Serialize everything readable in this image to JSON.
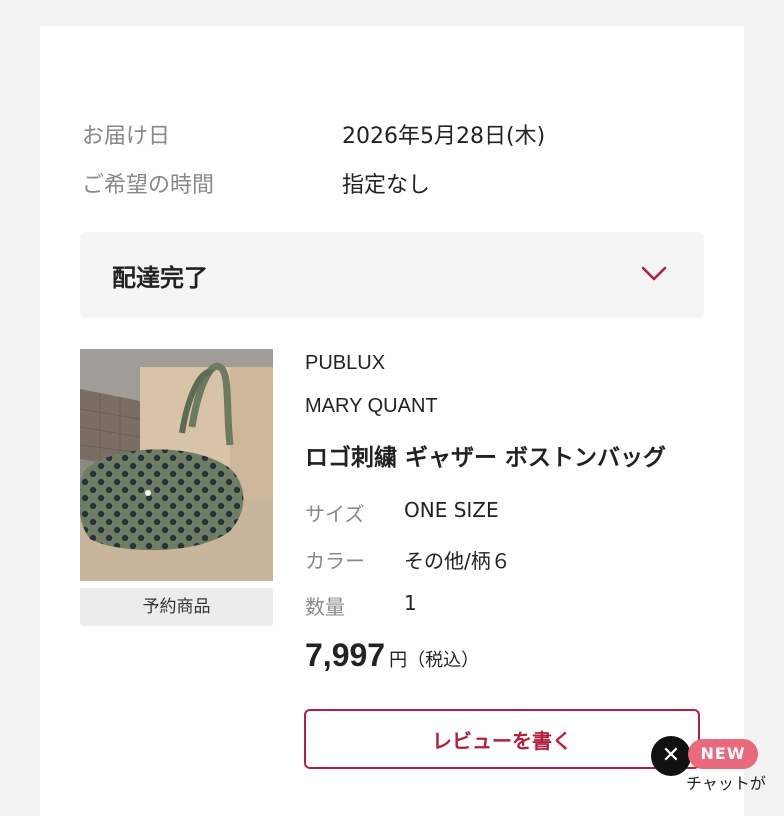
{
  "delivery": {
    "date_label": "お届け日",
    "date_value": "2026年5月28日(木)",
    "time_label": "ご希望の時間",
    "time_value": "指定なし"
  },
  "status": {
    "title": "配達完了",
    "chevron_icon": "chevron-down-icon",
    "accent_color": "#b3203f"
  },
  "product": {
    "badge": "予約商品",
    "brand1": "PUBLUX",
    "brand2": "MARY QUANT",
    "name": "ロゴ刺繍 ギャザー ボストンバッグ",
    "size_label": "サイズ",
    "size_value": "ONE SIZE",
    "color_label": "カラー",
    "color_value": "その他/柄６",
    "qty_label": "数量",
    "qty_value": "1",
    "price": "7,997",
    "price_unit": "円（税込）"
  },
  "actions": {
    "review_label": "レビューを書く"
  },
  "chat_widget": {
    "close_icon": "close-icon",
    "close_glyph": "✕",
    "badge": "NEW",
    "label": "チャットが"
  }
}
